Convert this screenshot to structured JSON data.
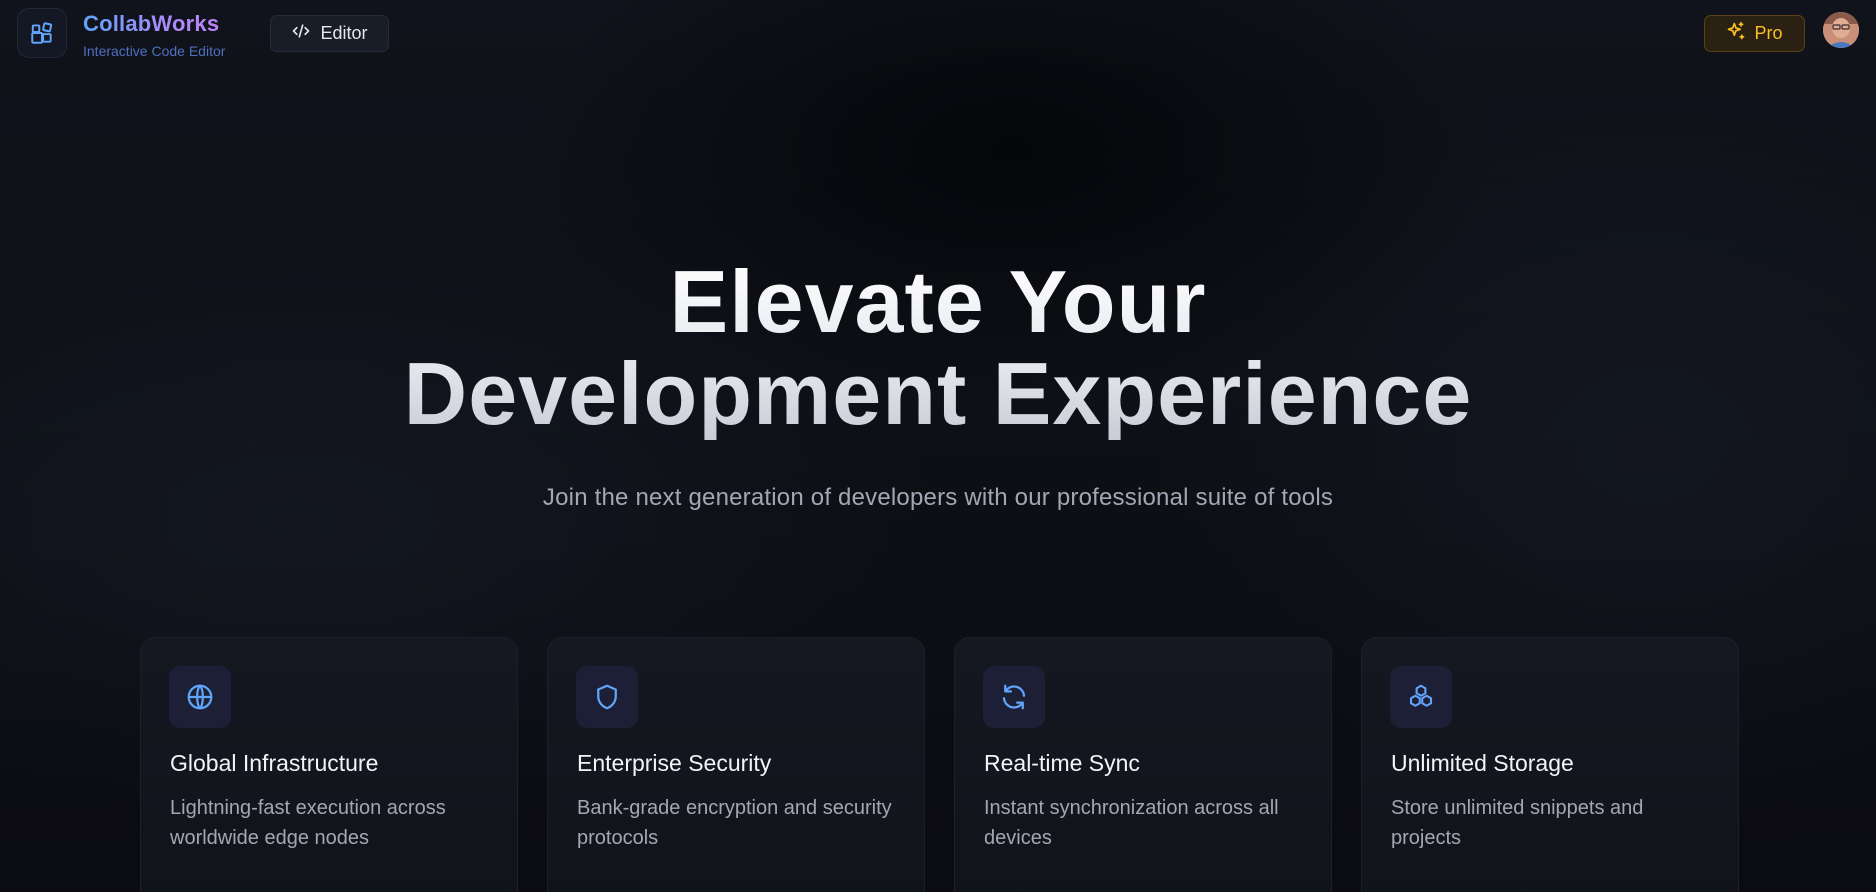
{
  "brand": {
    "name": "CollabWorks",
    "subtitle": "Interactive Code Editor"
  },
  "header": {
    "editor_label": "Editor",
    "pro_label": "Pro"
  },
  "hero": {
    "title_line1": "Elevate Your",
    "title_line2": "Development Experience",
    "subtitle": "Join the next generation of developers with our professional suite of tools"
  },
  "features": [
    {
      "icon": "globe-icon",
      "title": "Global Infrastructure",
      "description": "Lightning-fast execution across worldwide edge nodes"
    },
    {
      "icon": "shield-icon",
      "title": "Enterprise Security",
      "description": "Bank-grade encryption and security protocols"
    },
    {
      "icon": "refresh-icon",
      "title": "Real-time Sync",
      "description": "Instant synchronization across all devices"
    },
    {
      "icon": "boxes-icon",
      "title": "Unlimited Storage",
      "description": "Store unlimited snippets and projects"
    }
  ],
  "colors": {
    "accent_blue": "#60a5fa",
    "accent_purple": "#c084fc",
    "pro_gold": "#fbbf24",
    "background": "#0b0c11"
  }
}
